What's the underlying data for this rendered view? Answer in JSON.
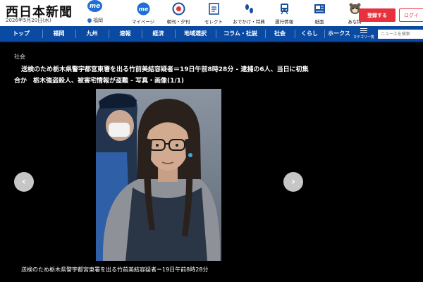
{
  "header": {
    "logo": "西日本新聞",
    "logo_badge": "me",
    "date": "2026年5月20日(水)",
    "location": "福岡",
    "nav": [
      {
        "label": "マイページ",
        "icon": "me-icon"
      },
      {
        "label": "朝刊・夕刊",
        "icon": "newspaper-icon"
      },
      {
        "label": "セレクト",
        "icon": "select-icon"
      },
      {
        "label": "おでかけ・特典",
        "icon": "footprints-icon"
      },
      {
        "label": "運行情報",
        "icon": "train-icon"
      },
      {
        "label": "紙面",
        "icon": "paper-icon"
      },
      {
        "label": "あな特",
        "icon": "raccoon-icon"
      }
    ],
    "register_label": "登録する",
    "login_label": "ログイ"
  },
  "catnav": {
    "items": [
      "トップ",
      "福岡",
      "九州",
      "速報",
      "経済",
      "地域選択",
      "コラム・社説",
      "社会",
      "くらし",
      "ホークス"
    ],
    "menu_label": "カテゴリ一覧",
    "search_placeholder": "ニュースを検索"
  },
  "article": {
    "section": "社会",
    "headline": "送検のため栃木県警宇都宮東署を出る竹前美結容疑者＝19日午前8時28分 - 逮捕の6人、当日に初集合か　栃木強盗殺人、被害宅情報が盗難 - 写真・画像(1/1)",
    "caption": "送検のため栃木県警宇都宮東署を出る竹前美結容疑者＝19日午前8時28分",
    "prev_glyph": "‹",
    "next_glyph": "›"
  },
  "colors": {
    "nav_blue": "#0a4aa3",
    "accent_red": "#e5323c",
    "badge_blue": "#1d6fd6"
  }
}
